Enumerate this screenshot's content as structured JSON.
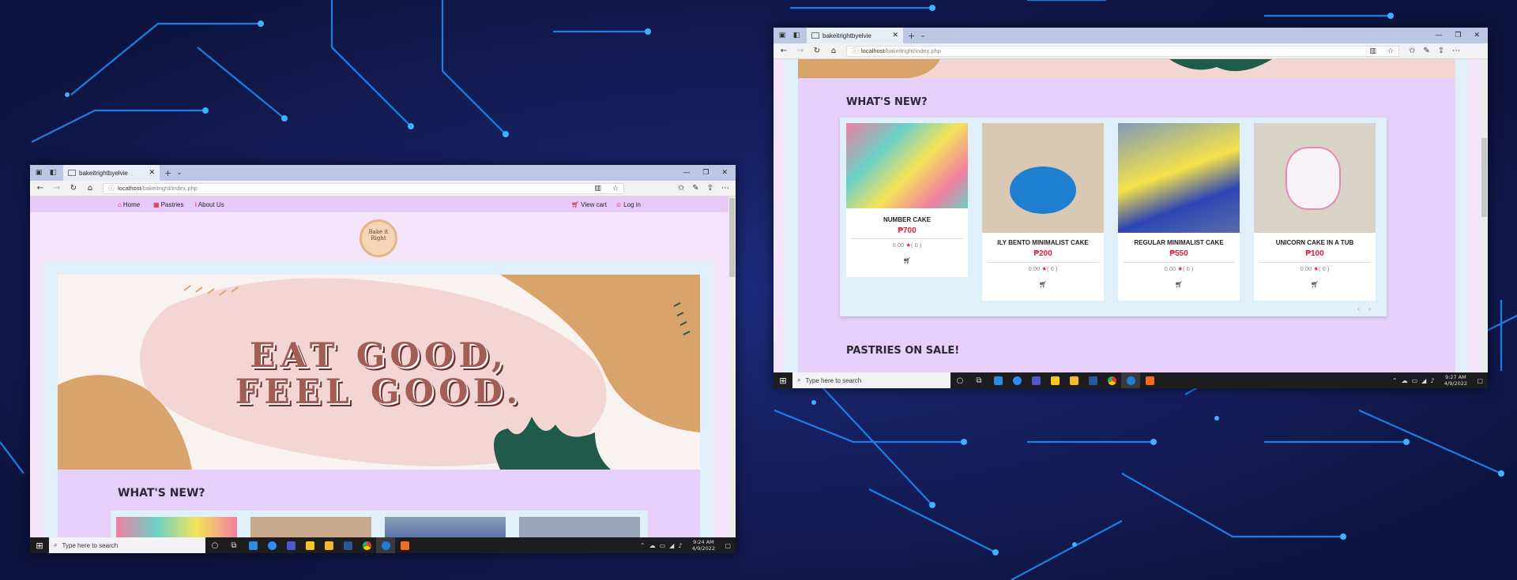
{
  "colors": {
    "accent": "#e11b3a",
    "nav_bg": "#e7caf7",
    "page_bg": "#f4e4fb",
    "section_bg": "#e6cff8",
    "frame_bg": "#dff0fb",
    "banner_text": "#a35d55",
    "wallpaper": "#121a4c"
  },
  "browser": {
    "tab_title": "bakeitrightbyelvie",
    "url_host": "localhost",
    "url_path": "/bakeitright/index.php",
    "icons": {
      "back": "back-arrow-icon",
      "forward": "forward-arrow-icon",
      "refresh": "refresh-icon",
      "home": "home-icon",
      "reading": "reading-view-icon",
      "favorite": "star-icon",
      "favorites": "favorites-bar-icon",
      "notes": "pen-icon",
      "share": "share-icon",
      "more": "more-icon"
    }
  },
  "site": {
    "nav": {
      "home": "Home",
      "pastries": "Pastries",
      "about": "About Us",
      "cart": "View cart",
      "login": "Log in"
    },
    "logo_text": "Bake it Right",
    "banner": {
      "line1": "EAT GOOD,",
      "line2": "FEEL GOOD."
    },
    "sections": {
      "whats_new": "WHAT'S NEW?",
      "on_sale": "PASTRIES ON SALE!"
    },
    "products": [
      {
        "name": "NUMBER CAKE",
        "price": "₱700",
        "rating": "0.00",
        "reviews": "( 0 )",
        "cart_icon": "cart-icon"
      },
      {
        "name": "ILY BENTO MINIMALIST CAKE",
        "price": "₱200",
        "rating": "0.00",
        "reviews": "( 0 )",
        "cart_icon": "cart-icon"
      },
      {
        "name": "REGULAR MINIMALIST CAKE",
        "price": "₱550",
        "rating": "0.00",
        "reviews": "( 0 )",
        "cart_icon": "cart-icon"
      },
      {
        "name": "UNICORN CAKE IN A TUB",
        "price": "₱100",
        "rating": "0.00",
        "reviews": "( 0 )",
        "cart_icon": "cart-icon"
      }
    ]
  },
  "taskbar": {
    "search_placeholder": "Type here to search",
    "apps": [
      "cortana-icon",
      "task-view-icon",
      "vscode-icon",
      "zoom-icon",
      "teams-icon",
      "sticky-notes-icon",
      "file-explorer-icon",
      "word-icon",
      "chrome-icon",
      "edge-icon",
      "xampp-icon"
    ],
    "window1": {
      "time": "9:24 AM",
      "date": "4/9/2022"
    },
    "window2": {
      "time": "9:27 AM",
      "date": "4/9/2022"
    }
  }
}
